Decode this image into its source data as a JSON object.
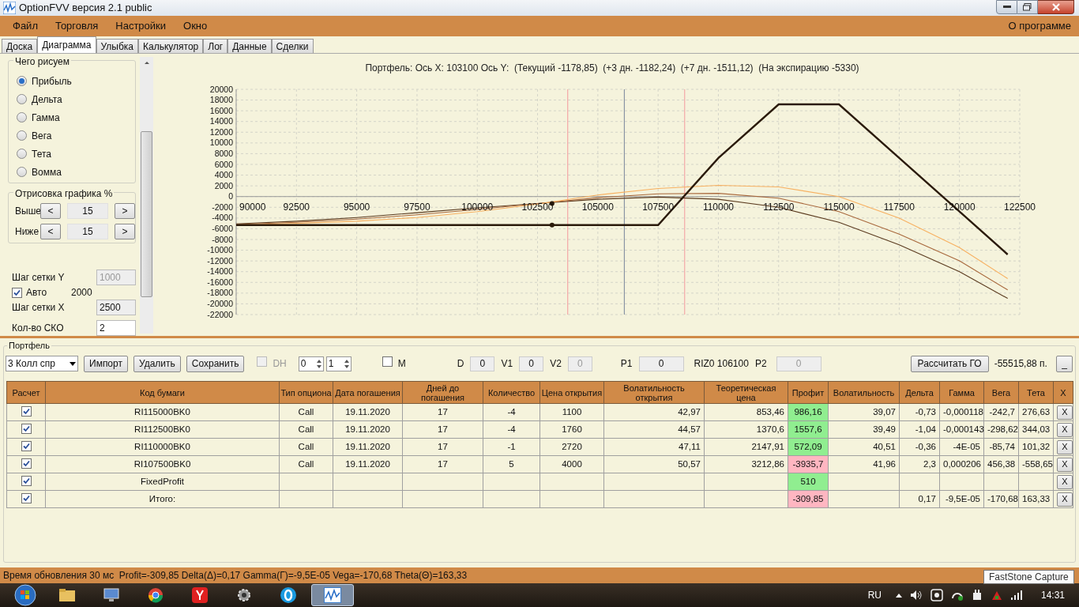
{
  "window": {
    "title": "OptionFVV версия 2.1 public"
  },
  "menu": {
    "items": [
      "Файл",
      "Торговля",
      "Настройки",
      "Окно"
    ],
    "right": "О программе"
  },
  "tabs": [
    {
      "label": "Доска",
      "selected": false
    },
    {
      "label": "Диаграмма",
      "selected": true
    },
    {
      "label": "Улыбка",
      "selected": false
    },
    {
      "label": "Калькулятор",
      "selected": false
    },
    {
      "label": "Лог",
      "selected": false
    },
    {
      "label": "Данные",
      "selected": false
    },
    {
      "label": "Сделки",
      "selected": false
    }
  ],
  "draw_panel": {
    "title": "Чего рисуем",
    "options": [
      {
        "label": "Прибыль",
        "selected": true
      },
      {
        "label": "Дельта",
        "selected": false
      },
      {
        "label": "Гамма",
        "selected": false
      },
      {
        "label": "Вега",
        "selected": false
      },
      {
        "label": "Тета",
        "selected": false
      },
      {
        "label": "Вомма",
        "selected": false
      }
    ]
  },
  "range_panel": {
    "title": "Отрисовка графика %",
    "rows": [
      {
        "label": "Выше",
        "dec": "<",
        "value": "15",
        "inc": ">"
      },
      {
        "label": "Ниже",
        "dec": "<",
        "value": "15",
        "inc": ">"
      }
    ]
  },
  "grid_settings": {
    "y_step": {
      "label": "Шаг сетки Y",
      "value": "1000",
      "disabled": true
    },
    "auto": {
      "label": "Авто",
      "checked": true,
      "value": "2000"
    },
    "x_step": {
      "label": "Шаг сетки X",
      "value": "2500"
    },
    "sko": {
      "label": "Кол-во СКО",
      "value": "2"
    }
  },
  "chart": {
    "chart_data": {
      "type": "line",
      "title": "Портфель: Ось X: 103100 Ось Y:  (Текущий -1178,85)  (+3 дн. -1182,24)  (+7 дн. -1511,12)  (На экспирацию -5330)",
      "x": [
        90000,
        92500,
        95000,
        97500,
        100000,
        102500,
        105000,
        107500,
        110000,
        112500,
        115000,
        117500,
        120000,
        122000
      ],
      "series": [
        {
          "color": "#5a3a1e",
          "values": [
            -5100,
            -4600,
            -3900,
            -3000,
            -2100,
            -1300,
            -500,
            -100,
            -500,
            -2000,
            -4800,
            -9000,
            -14000,
            -19000
          ]
        },
        {
          "color": "#a8683c",
          "values": [
            -5200,
            -4800,
            -4200,
            -3400,
            -2400,
            -1300,
            -200,
            500,
            600,
            -300,
            -2800,
            -7000,
            -12000,
            -17400
          ]
        },
        {
          "color": "#f7b060",
          "values": [
            -5300,
            -5000,
            -4600,
            -3900,
            -2800,
            -1400,
            300,
            1500,
            2100,
            1800,
            0,
            -4000,
            -9500,
            -15300
          ]
        },
        {
          "color": "#2a1a0a",
          "values": [
            -5300,
            -5300,
            -5300,
            -5300,
            -5300,
            -5300,
            -5300,
            -5300,
            7200,
            17200,
            17200,
            7200,
            -2800,
            -10800
          ]
        }
      ],
      "grid": true,
      "xlim": [
        90000,
        122500
      ],
      "ylim": [
        -22000,
        20000
      ],
      "xticks": [
        90000,
        92500,
        95000,
        97500,
        100000,
        102500,
        105000,
        107500,
        110000,
        112500,
        115000,
        117500,
        120000,
        122500
      ],
      "yticks": [
        -22000,
        -20000,
        -18000,
        -16000,
        -14000,
        -12000,
        -10000,
        -8000,
        -6000,
        -4000,
        -2000,
        0,
        2000,
        4000,
        6000,
        8000,
        10000,
        12000,
        14000,
        16000,
        18000,
        20000
      ],
      "ref_lines": [
        {
          "axis": "x",
          "value": 103750,
          "color": "#f4a8a8"
        },
        {
          "axis": "x",
          "value": 106100,
          "color": "#8a94a4"
        },
        {
          "axis": "x",
          "value": 108600,
          "color": "#f4a8a8"
        }
      ]
    }
  },
  "portfolio": {
    "title": "Портфель",
    "strategy": "3 Колл спр",
    "buttons": [
      "Импорт",
      "Удалить",
      "Сохранить"
    ],
    "dh": {
      "label": "DH",
      "checked": false,
      "disabled": true
    },
    "spinners": [
      "0",
      "1"
    ],
    "m": {
      "label": "M",
      "checked": false
    },
    "fields": [
      {
        "label": "D",
        "value": "0",
        "disabled": false
      },
      {
        "label": "V1",
        "value": "0",
        "disabled": false
      },
      {
        "label": "V2",
        "value": "0",
        "disabled": true
      },
      {
        "label": "P1",
        "value": "0",
        "disabled": false
      }
    ],
    "instrument": "RIZ0 106100",
    "p2": {
      "label": "P2",
      "value": "0",
      "disabled": true
    },
    "go_button": "Рассчитать ГО",
    "go_value": "-55515,88 п.",
    "collapse_button": "_"
  },
  "table": {
    "columns": [
      "Расчет",
      "Код бумаги",
      "Тип опциона",
      "Дата погашения",
      "Дней до погашения",
      "Количество",
      "Цена открытия",
      "Волатильность открытия",
      "Теоретическая цена",
      "Профит",
      "Волатильность",
      "Дельта",
      "Гамма",
      "Вега",
      "Тета",
      "X"
    ],
    "rows": [
      {
        "calc": true,
        "code": "RI115000BK0",
        "type": "Call",
        "date": "19.11.2020",
        "days": "17",
        "qty": "-4",
        "price": "1100",
        "vol_open": "42,97",
        "theor": "853,46",
        "profit": {
          "text": "986,16",
          "color": "#90ee90"
        },
        "vol": "39,07",
        "delta": "-0,73",
        "gamma": "-0,000118",
        "vega": "-242,7",
        "theta": "276,63",
        "remove": "X"
      },
      {
        "calc": true,
        "code": "RI112500BK0",
        "type": "Call",
        "date": "19.11.2020",
        "days": "17",
        "qty": "-4",
        "price": "1760",
        "vol_open": "44,57",
        "theor": "1370,6",
        "profit": {
          "text": "1557,6",
          "color": "#90ee90"
        },
        "vol": "39,49",
        "delta": "-1,04",
        "gamma": "-0,000143",
        "vega": "-298,62",
        "theta": "344,03",
        "remove": "X"
      },
      {
        "calc": true,
        "code": "RI110000BK0",
        "type": "Call",
        "date": "19.11.2020",
        "days": "17",
        "qty": "-1",
        "price": "2720",
        "vol_open": "47,11",
        "theor": "2147,91",
        "profit": {
          "text": "572,09",
          "color": "#90ee90"
        },
        "vol": "40,51",
        "delta": "-0,36",
        "gamma": "-4E-05",
        "vega": "-85,74",
        "theta": "101,32",
        "remove": "X"
      },
      {
        "calc": true,
        "code": "RI107500BK0",
        "type": "Call",
        "date": "19.11.2020",
        "days": "17",
        "qty": "5",
        "price": "4000",
        "vol_open": "50,57",
        "theor": "3212,86",
        "profit": {
          "text": "-3935,7",
          "color": "#ffb6c1"
        },
        "vol": "41,96",
        "delta": "2,3",
        "gamma": "0,000206",
        "vega": "456,38",
        "theta": "-558,65",
        "remove": "X"
      },
      {
        "calc": true,
        "code": "FixedProfit",
        "profit": {
          "text": "510",
          "color": "#90ee90"
        },
        "remove": "X"
      },
      {
        "calc": true,
        "code": "Итого:",
        "profit": {
          "text": "-309,85",
          "color": "#ffb6c1"
        },
        "delta": "0,17",
        "gamma": "-9,5E-05",
        "vega": "-170,68",
        "theta": "163,33",
        "remove": "X"
      }
    ]
  },
  "status_bar": "Время обновления 30 мс  Profit=-309,85 Delta(Δ)=0,17 Gamma(Γ)=-9,5E-05 Vega=-170,68 Theta(Θ)=163,33",
  "tooltip": "FastStone Capture",
  "taskbar": {
    "language": "RU",
    "time": "14:31"
  }
}
